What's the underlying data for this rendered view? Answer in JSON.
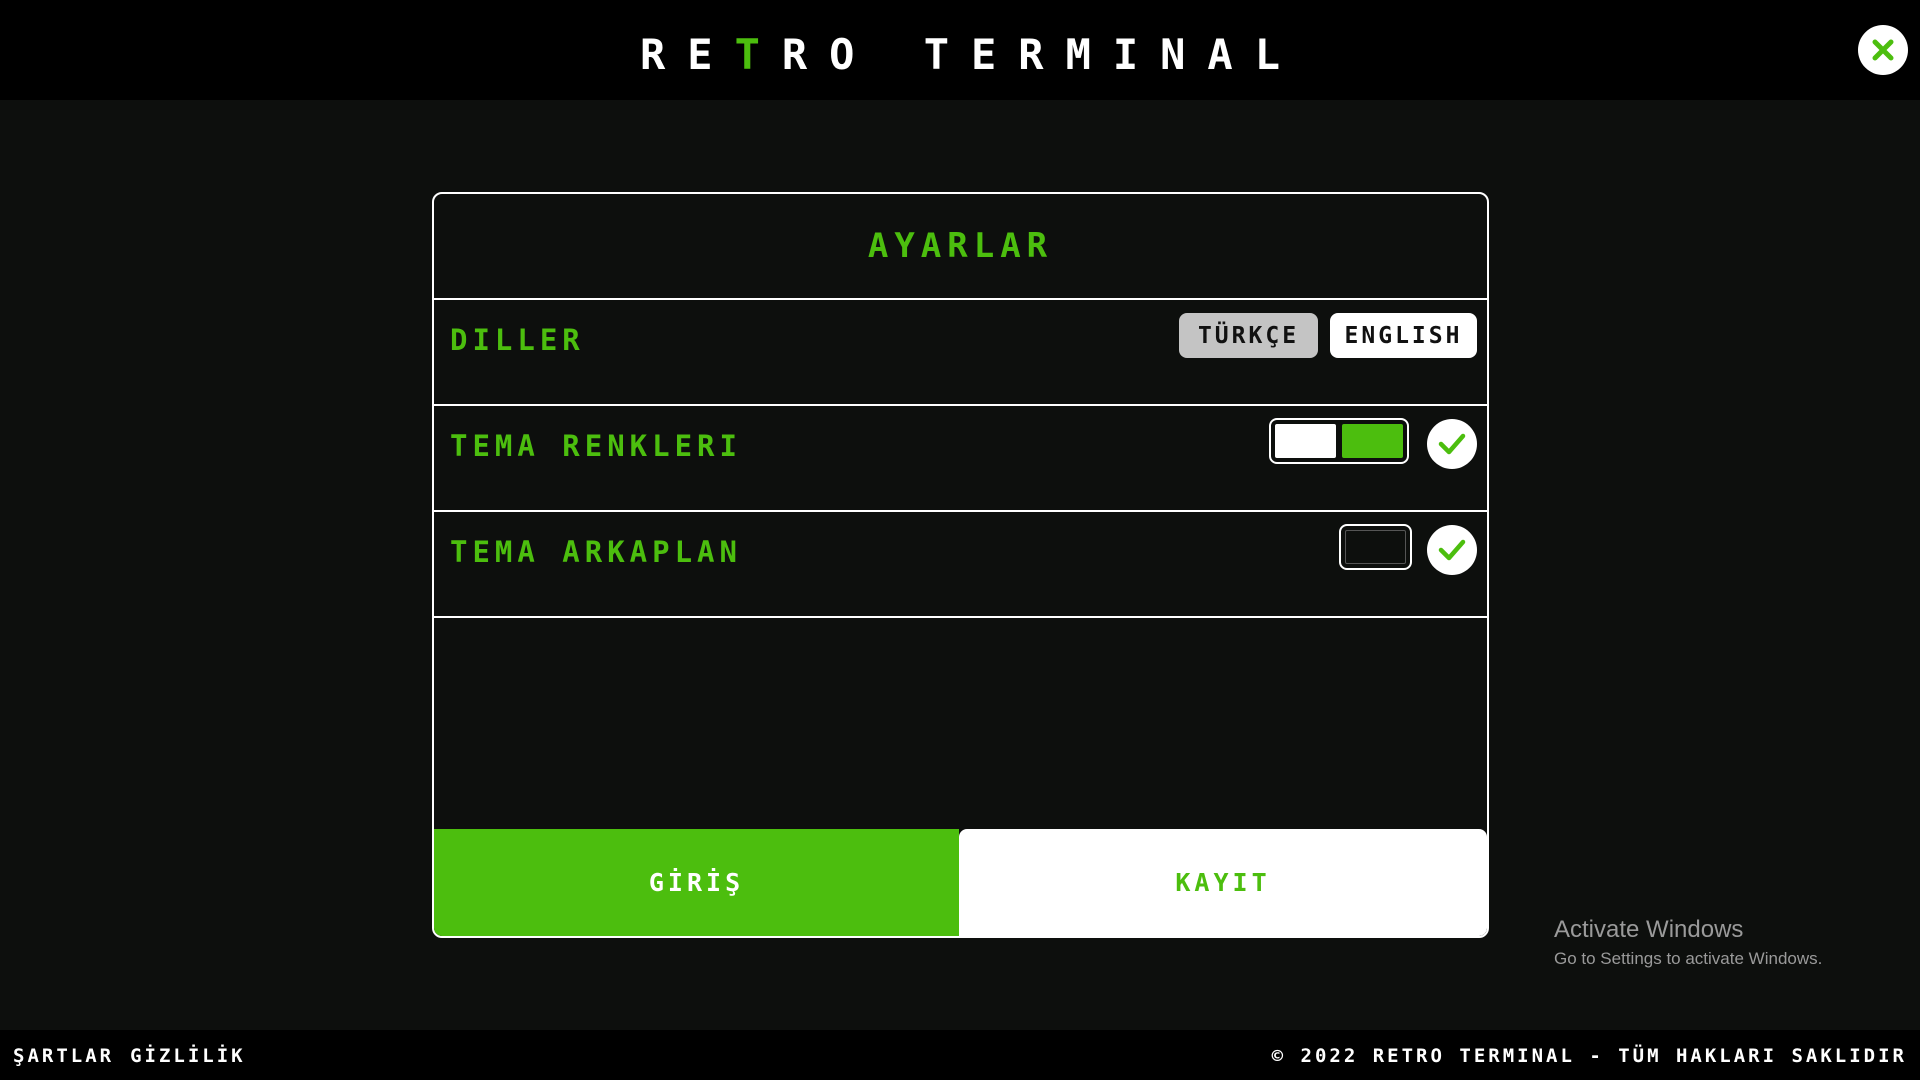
{
  "header": {
    "title_pre": "RE",
    "title_accent": "T",
    "title_post": "RO TERMINAL"
  },
  "settings": {
    "title": "AYARLAR",
    "languages": {
      "label": "DILLER",
      "options": [
        "TÜRKÇE",
        "ENGLISH"
      ],
      "selected": "TÜRKÇE"
    },
    "theme_colors": {
      "label": "TEMA RENKLERI",
      "swatches": [
        "#ffffff",
        "#4cbe0e"
      ]
    },
    "theme_background": {
      "label": "TEMA ARKAPLAN",
      "swatches": [
        "#0d0f0d"
      ]
    }
  },
  "actions": {
    "login_label": "GİRİŞ",
    "register_label": "KAYIT"
  },
  "footer": {
    "terms": "ŞARTLAR",
    "privacy": "GİZLİLİK",
    "copyright": "© 2022 RETRO TERMINAL - TÜM HAKLARI SAKLIDIR"
  },
  "watermark": {
    "title": "Activate Windows",
    "subtitle": "Go to Settings to activate Windows."
  },
  "colors": {
    "accent": "#4cbe0e",
    "background": "#0d0f0d",
    "bar": "#000000",
    "selected_lang_bg": "#c4c4c4"
  },
  "icons": {
    "close": "close-icon",
    "confirm": "check-icon"
  }
}
